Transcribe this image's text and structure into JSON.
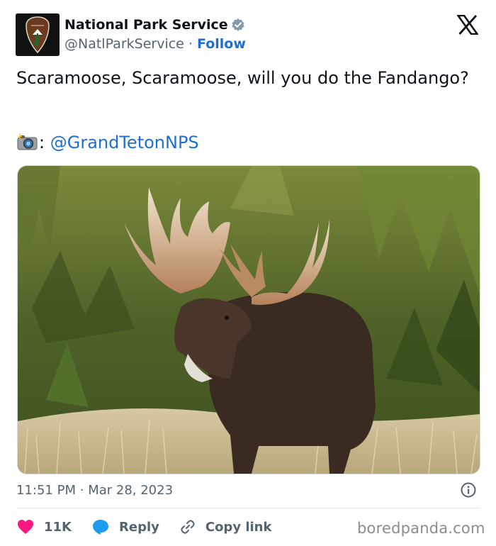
{
  "author": {
    "name": "National Park Service",
    "handle": "@NatlParkService",
    "separator": "·",
    "follow_label": "Follow",
    "verified_icon": "verified-badge-icon",
    "verified_color": "#829aab"
  },
  "platform_logo": "x-logo-icon",
  "tweet": {
    "text": "Scaramoose, Scaramoose, will you do the Fandango?",
    "credit_icon": "camera-flash-icon",
    "credit_colon": ":",
    "credit_mention": "@GrandTetonNPS"
  },
  "timestamp": {
    "time": "11:51 PM",
    "separator": "·",
    "date": "Mar 28, 2023"
  },
  "actions": {
    "like_count": "11K",
    "reply_label": "Reply",
    "copy_link_label": "Copy link"
  },
  "watermark": "boredpanda.com",
  "colors": {
    "link": "#1d6fd1",
    "like": "#f91880",
    "reply": "#1d9bf0",
    "muted": "#536471"
  }
}
